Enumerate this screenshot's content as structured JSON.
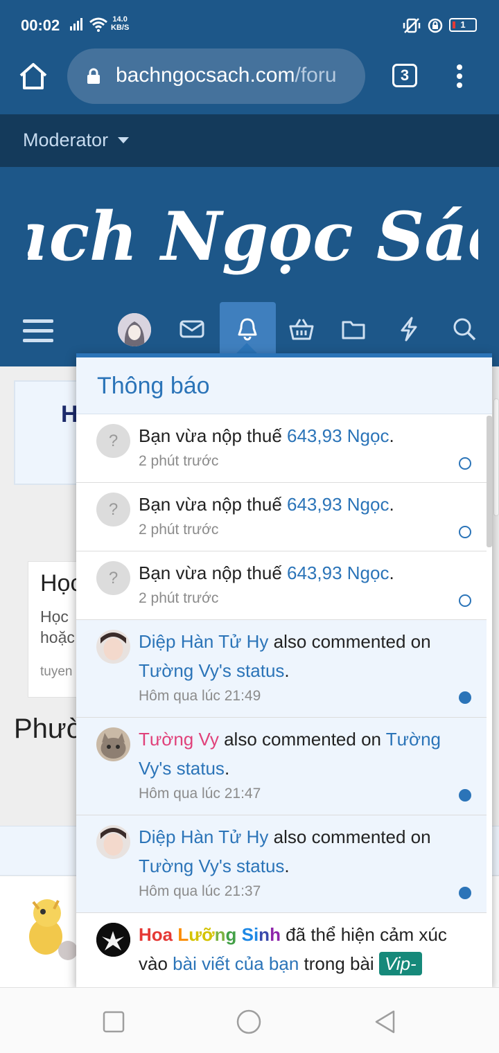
{
  "status_bar": {
    "time": "00:02",
    "speed_value": "14.0",
    "speed_unit": "KB/S",
    "battery": "1"
  },
  "browser": {
    "url_host": "bachngocsach.com",
    "url_path": "/foru",
    "tab_count": "3"
  },
  "moderator_menu": {
    "label": "Moderator"
  },
  "header": {
    "logo_text": "Bạch Ngọc Sách"
  },
  "background": {
    "panel_heading": "H",
    "card_title": "Học",
    "card_line1": "Học",
    "card_line2": "hoặc",
    "card_meta": "tuyen",
    "section_heading": "Phườ"
  },
  "notifications": {
    "title": "Thông báo",
    "items": [
      {
        "actor": "",
        "prefix": "Bạn vừa nộp thuế ",
        "link": "643,93 Ngọc",
        "suffix": ".",
        "time": "2 phút trước",
        "read": true
      },
      {
        "actor": "",
        "prefix": "Bạn vừa nộp thuế ",
        "link": "643,93 Ngọc",
        "suffix": ".",
        "time": "2 phút trước",
        "read": true
      },
      {
        "actor": "",
        "prefix": "Bạn vừa nộp thuế ",
        "link": "643,93 Ngọc",
        "suffix": ".",
        "time": "2 phút trước",
        "read": true
      },
      {
        "actor": "Diệp Hàn Tử Hy",
        "prefix": " also commented on ",
        "link": "Tường Vy's status",
        "suffix": ".",
        "time": "Hôm qua lúc 21:49",
        "read": false
      },
      {
        "actor": "Tường Vy",
        "prefix": " also commented on ",
        "link": "Tường Vy's status",
        "suffix": ".",
        "time": "Hôm qua lúc 21:47",
        "read": false
      },
      {
        "actor": "Diệp Hàn Tử Hy",
        "prefix": " also commented on ",
        "link": "Tường Vy's status",
        "suffix": ".",
        "time": "Hôm qua lúc 21:37",
        "read": false
      },
      {
        "actor": "Hoa Lưỡng Sinh",
        "prefix": " đã thể hiện cảm xúc vào ",
        "link": "bài viết của bạn",
        "suffix": " trong bài ",
        "badge": "Vip-",
        "time": "",
        "read": false
      }
    ]
  },
  "colors": {
    "brand_blue": "#1d5789",
    "dark_bar": "#143a5b",
    "accent": "#2b74b8",
    "unread_bg": "#eef5fd",
    "pink_user": "#e0417a",
    "badge_green": "#16897a"
  },
  "icons": {
    "nav": [
      "menu-icon",
      "avatar",
      "inbox-icon",
      "bell-icon",
      "basket-icon",
      "folder-icon",
      "bolt-icon",
      "search-icon"
    ],
    "system": [
      "recents-icon",
      "home-circle-icon",
      "back-icon"
    ]
  }
}
